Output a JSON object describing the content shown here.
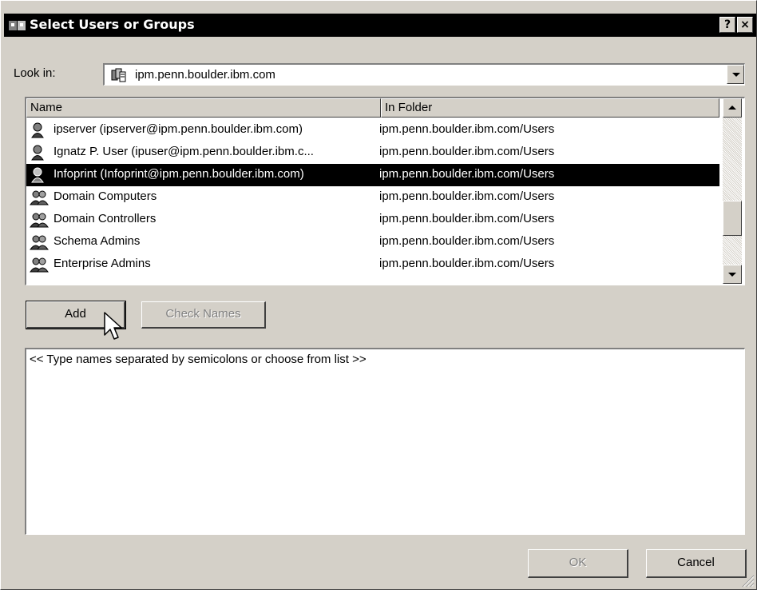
{
  "window": {
    "title": "Select Users or Groups",
    "help_label": "?",
    "close_label": "×"
  },
  "look_in": {
    "label": "Look in:",
    "value": "ipm.penn.boulder.ibm.com"
  },
  "list": {
    "columns": [
      "Name",
      "In Folder"
    ],
    "rows": [
      {
        "name": "ipserver (ipserver@ipm.penn.boulder.ibm.com)",
        "folder": "ipm.penn.boulder.ibm.com/Users",
        "icon": "user-icon",
        "selected": false
      },
      {
        "name": "Ignatz P. User (ipuser@ipm.penn.boulder.ibm.c...",
        "folder": "ipm.penn.boulder.ibm.com/Users",
        "icon": "user-icon",
        "selected": false
      },
      {
        "name": "Infoprint (Infoprint@ipm.penn.boulder.ibm.com)",
        "folder": "ipm.penn.boulder.ibm.com/Users",
        "icon": "user-icon",
        "selected": true
      },
      {
        "name": "Domain Computers",
        "folder": "ipm.penn.boulder.ibm.com/Users",
        "icon": "group-icon",
        "selected": false
      },
      {
        "name": "Domain Controllers",
        "folder": "ipm.penn.boulder.ibm.com/Users",
        "icon": "group-icon",
        "selected": false
      },
      {
        "name": "Schema Admins",
        "folder": "ipm.penn.boulder.ibm.com/Users",
        "icon": "group-icon",
        "selected": false
      },
      {
        "name": "Enterprise Admins",
        "folder": "ipm.penn.boulder.ibm.com/Users",
        "icon": "group-icon",
        "selected": false
      }
    ]
  },
  "buttons": {
    "add": "Add",
    "check_names": "Check Names",
    "ok": "OK",
    "cancel": "Cancel"
  },
  "names_box": {
    "placeholder": "<< Type names separated by semicolons or choose from list >>"
  },
  "colors": {
    "face": "#d4d0c8",
    "selection": "#000000",
    "titlebar": "#000000"
  }
}
